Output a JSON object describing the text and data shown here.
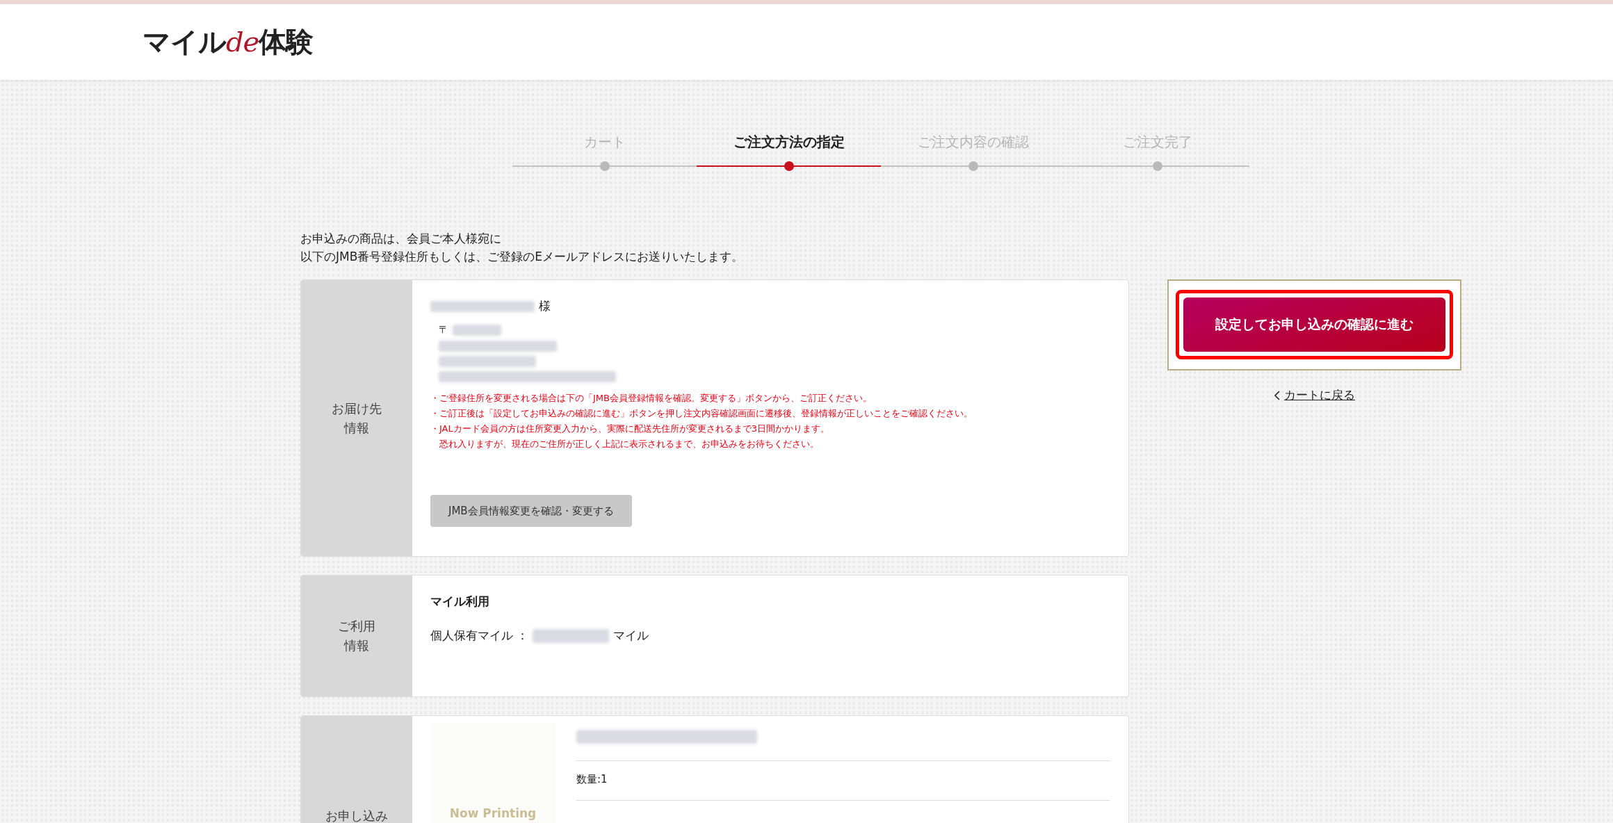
{
  "header": {
    "logo": {
      "part_1": "マイル",
      "part_2": "de",
      "part_3": "体験"
    }
  },
  "steps": [
    {
      "label": "カート",
      "selected": false
    },
    {
      "label": "ご注文方法の指定",
      "selected": true
    },
    {
      "label": "ご注文内容の確認",
      "selected": false
    },
    {
      "label": "ご注文完了",
      "selected": false
    }
  ],
  "intro": [
    "お申込みの商品は、会員ご本人様宛に",
    "以下のJMB番号登録住所もしくは、ご登録のEメールアドレスにお送りいたします。"
  ],
  "delivery": {
    "label": [
      "お届け先",
      "情報"
    ],
    "honorific": "様",
    "postal_mark": "〒",
    "notes": [
      {
        "kind": "bullet",
        "text": "・ご登録住所を変更される場合は下の「JMB会員登録情報を確認。変更する」ボタンから、ご訂正ください。"
      },
      {
        "kind": "bullet",
        "text": "・ご訂正後は「設定してお申込みの確認に進む」ボタンを押し注文内容確認画面に遷移後、登録情報が正しいことをご確認ください。"
      },
      {
        "kind": "bullet",
        "text": "・JALカード会員の方は住所変更入力から、実際に配送先住所が変更されるまで3日間かかります。"
      },
      {
        "kind": "continuation",
        "text": "恐れ入りますが、現在のご住所が正しく上記に表示されるまで、お申込みをお待ちください。"
      }
    ],
    "button": "JMB会員情報変更を確認・変更する"
  },
  "usage": {
    "label": [
      "ご利用",
      "情報"
    ],
    "heading": "マイル利用",
    "field_label": "個人保有マイル ：",
    "unit": "マイル"
  },
  "order": {
    "label": [
      "お申し込み"
    ],
    "image_text": "Now Printing",
    "quantity": "数量:1"
  },
  "actions": {
    "submit": "設定してお申し込みの確認に進む",
    "submit_highlighted": true,
    "back_link": "カートに戻る"
  }
}
